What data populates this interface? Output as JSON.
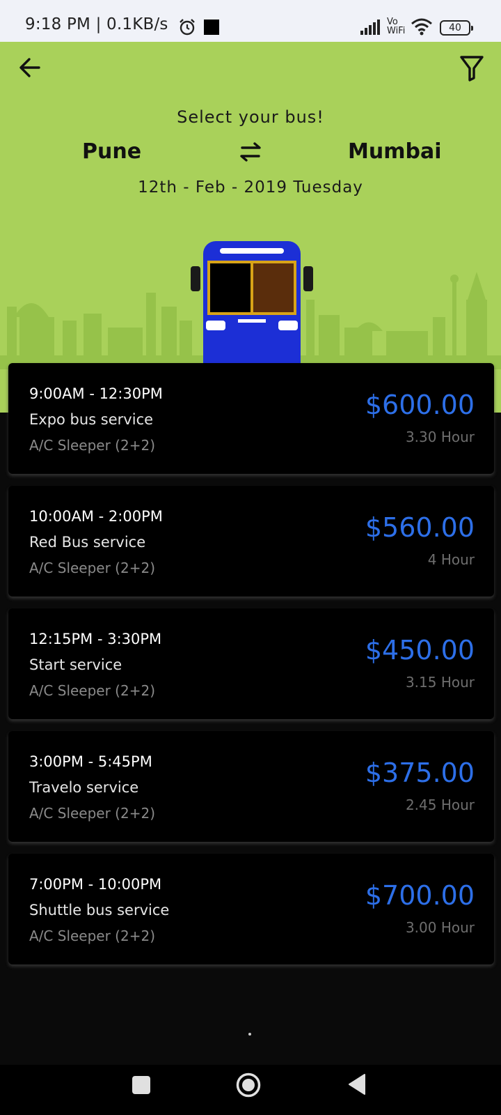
{
  "status_bar": {
    "time": "9:18 PM | 0.1KB/s",
    "vowifi_top": "Vo",
    "vowifi_bottom": "WiFi",
    "battery": "40"
  },
  "header": {
    "title": "Select your bus!",
    "from_city": "Pune",
    "to_city": "Mumbai",
    "date": "12th - Feb - 2019 Tuesday"
  },
  "colors": {
    "header_bg": "#a9d15a",
    "price": "#2d6fe8",
    "bus_body": "#1c2fd6"
  },
  "trips": [
    {
      "time": "9:00AM - 12:30PM",
      "name": "Expo bus service",
      "type": "A/C Sleeper (2+2)",
      "price": "$600.00",
      "duration": "3.30 Hour"
    },
    {
      "time": "10:00AM - 2:00PM",
      "name": "Red Bus service",
      "type": "A/C Sleeper (2+2)",
      "price": "$560.00",
      "duration": "4 Hour"
    },
    {
      "time": "12:15PM - 3:30PM",
      "name": "Start service",
      "type": "A/C Sleeper (2+2)",
      "price": "$450.00",
      "duration": "3.15 Hour"
    },
    {
      "time": "3:00PM - 5:45PM",
      "name": "Travelo service",
      "type": "A/C Sleeper (2+2)",
      "price": "$375.00",
      "duration": "2.45 Hour"
    },
    {
      "time": "7:00PM - 10:00PM",
      "name": "Shuttle bus service",
      "type": "A/C Sleeper (2+2)",
      "price": "$700.00",
      "duration": "3.00 Hour"
    }
  ]
}
